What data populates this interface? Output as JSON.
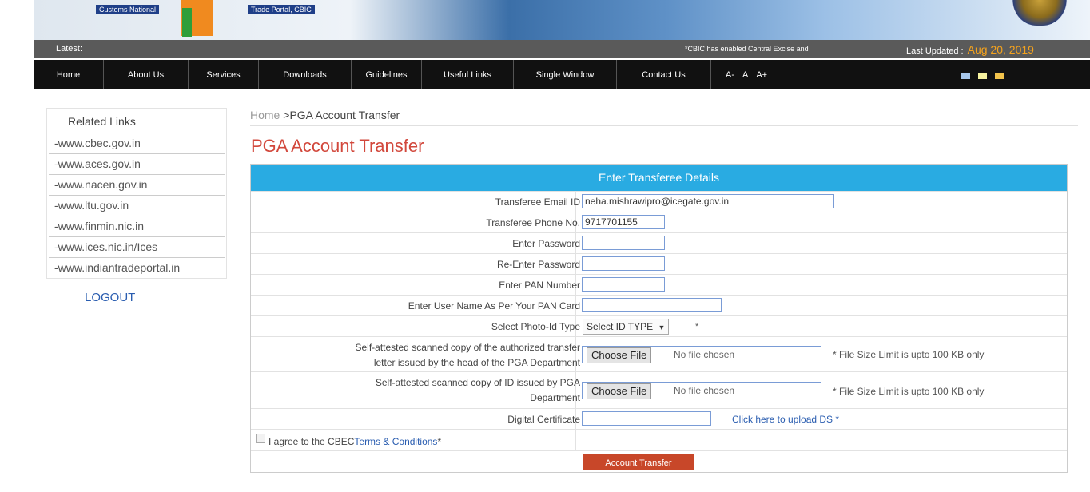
{
  "banner": {
    "left_label": "Customs National",
    "right_label": "Trade Portal, CBIC"
  },
  "ticker": {
    "latest_label": "Latest:",
    "news": "*CBIC has enabled Central Excise and",
    "last_updated_label": "Last Updated :",
    "last_updated_date": "Aug 20, 2019"
  },
  "nav": {
    "items": [
      "Home",
      "About Us",
      "Services",
      "Downloads",
      "Guidelines",
      "Useful Links",
      "Single Window",
      "Contact Us"
    ],
    "font_sizes": [
      "A-",
      "A",
      "A+"
    ],
    "theme_colors": [
      "#a8c8ec",
      "#f7f3a0",
      "#f2c34c"
    ]
  },
  "sidebar": {
    "heading": "Related Links",
    "links": [
      "-www.cbec.gov.in",
      "-www.aces.gov.in",
      "-www.nacen.gov.in",
      "-www.ltu.gov.in",
      "-www.finmin.nic.in",
      "-www.ices.nic.in/Ices",
      "-www.indiantradeportal.in"
    ],
    "logout": "LOGOUT"
  },
  "breadcrumb": {
    "home": "Home",
    "separator": " >",
    "current": "PGA Account Transfer"
  },
  "page_title": "PGA Account Transfer",
  "form": {
    "header": "Enter Transferee Details",
    "email_label": "Transferee Email ID",
    "email_value": "neha.mishrawipro@icegate.gov.in",
    "phone_label": "Transferee Phone No.",
    "phone_value": "9717701155",
    "password_label": "Enter Password",
    "reenter_password_label": "Re-Enter Password",
    "pan_label": "Enter PAN Number",
    "pan_name_label": "Enter User Name As Per Your PAN Card",
    "photo_id_label": "Select Photo-Id Type",
    "photo_id_selected": "Select ID TYPE",
    "transfer_letter_label_1": "Self-attested scanned copy of the authorized transfer",
    "transfer_letter_label_2": "letter issued by the head of the PGA Department",
    "id_copy_label_1": "Self-attested scanned copy of ID issued by PGA",
    "id_copy_label_2": "Department",
    "choose_file": "Choose File",
    "no_file": "No file chosen",
    "size_note": "* File Size Limit is upto 100 KB only",
    "required_marker": "*",
    "digital_cert_label": "Digital Certificate",
    "ds_link": "Click here to upload DS *",
    "agree_text": "I agree to the CBEC",
    "terms_link": "Terms & Conditions",
    "submit": "Account Transfer"
  },
  "colors": {
    "nav_bg": "#111111",
    "ticker_bg": "#5a5a5a",
    "header_blue": "#29abe2",
    "title_red": "#d2483c",
    "button_red": "#c84729",
    "date_orange": "#f4a21d",
    "link_blue": "#2a5db0"
  }
}
